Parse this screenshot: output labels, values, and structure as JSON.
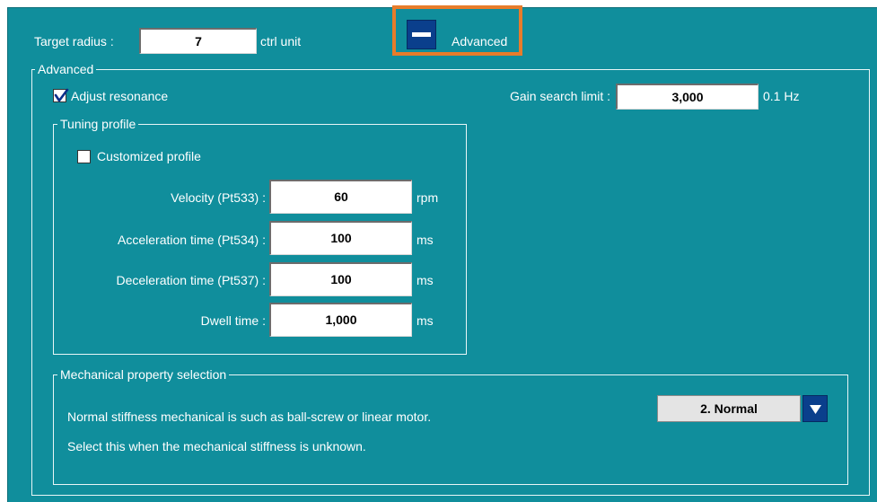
{
  "top": {
    "target_radius_label": "Target radius :",
    "target_radius_value": "7",
    "target_radius_unit": "ctrl unit",
    "advanced_button_label": "Advanced"
  },
  "advanced": {
    "group_title": "Advanced",
    "adjust_resonance_label": "Adjust resonance",
    "adjust_resonance_checked": true,
    "gain_search_label": "Gain search limit :",
    "gain_search_value": "3,000",
    "gain_search_unit": "0.1 Hz"
  },
  "tuning_profile": {
    "group_title": "Tuning profile",
    "customized_label": "Customized profile",
    "customized_checked": false,
    "rows": [
      {
        "label": "Velocity (Pt533) :",
        "value": "60",
        "unit": "rpm"
      },
      {
        "label": "Acceleration time (Pt534) :",
        "value": "100",
        "unit": "ms"
      },
      {
        "label": "Deceleration time (Pt537) :",
        "value": "100",
        "unit": "ms"
      },
      {
        "label": "Dwell time :",
        "value": "1,000",
        "unit": "ms"
      }
    ]
  },
  "mechanical": {
    "group_title": "Mechanical property selection",
    "description_line1": "Normal stiffness mechanical is such as ball-screw or linear motor.",
    "description_line2": "Select this when the mechanical stiffness is unknown.",
    "selected_option": "2. Normal"
  },
  "icons": {
    "advanced_toggle": "minus-icon",
    "dropdown": "triangle-down-icon",
    "check": "check-icon"
  },
  "colors": {
    "panel_background": "#108e9c",
    "button_blue": "#0a3f8c",
    "highlight_orange": "#e87c2a"
  }
}
